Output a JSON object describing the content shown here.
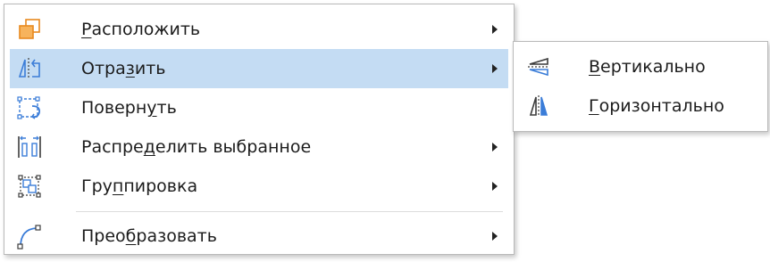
{
  "main_menu": {
    "items": [
      {
        "label_pre": "",
        "mnemonic": "Р",
        "label_post": "асположить",
        "icon": "arrange-icon",
        "submenu": true
      },
      {
        "label_pre": "Отра",
        "mnemonic": "з",
        "label_post": "ить",
        "icon": "flip-icon",
        "submenu": true,
        "selected": true
      },
      {
        "label_pre": "Поверн",
        "mnemonic": "у",
        "label_post": "ть",
        "icon": "rotate-icon",
        "submenu": false
      },
      {
        "label_pre": "Распре",
        "mnemonic": "д",
        "label_post": "елить выбранное",
        "icon": "distribute-icon",
        "submenu": true
      },
      {
        "label_pre": "Гру",
        "mnemonic": "п",
        "label_post": "пировка",
        "icon": "group-icon",
        "submenu": true
      },
      {
        "label_pre": "Прео",
        "mnemonic": "б",
        "label_post": "разовать",
        "icon": "convert-icon",
        "submenu": true
      }
    ]
  },
  "sub_menu": {
    "items": [
      {
        "label_pre": "",
        "mnemonic": "В",
        "label_post": "ертикально",
        "icon": "flip-vertical-icon"
      },
      {
        "label_pre": "",
        "mnemonic": "Г",
        "label_post": "оризонтально",
        "icon": "flip-horizontal-icon"
      }
    ]
  },
  "colors": {
    "selection": "#c4dcf3",
    "icon_orange": "#e8891f",
    "icon_blue": "#3b7dd8",
    "icon_dark": "#3c3c3c",
    "border": "#b9b9b9"
  }
}
